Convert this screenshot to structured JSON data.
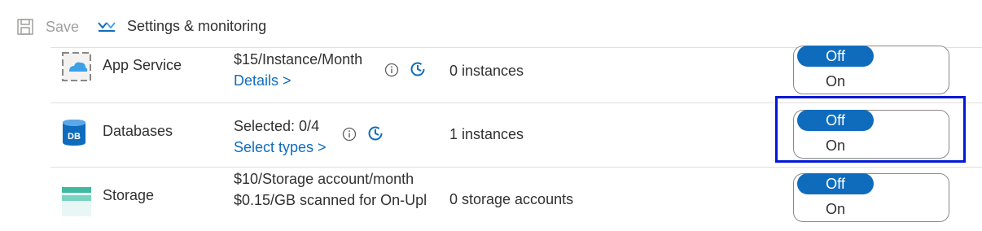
{
  "toolbar": {
    "save_label": "Save",
    "settings_label": "Settings & monitoring"
  },
  "plans": [
    {
      "name": "App Service",
      "icon": "app-service-icon",
      "pricing_line1": "$15/Instance/Month",
      "pricing_link": "Details >",
      "count": "0 instances",
      "toggle_off": "Off",
      "toggle_on": "On",
      "selected": "Off"
    },
    {
      "name": "Databases",
      "icon": "database-icon",
      "icon_text": "DB",
      "pricing_line1": "Selected: 0/4",
      "pricing_link": "Select types >",
      "count": "1 instances",
      "toggle_off": "Off",
      "toggle_on": "On",
      "selected": "Off"
    },
    {
      "name": "Storage",
      "icon": "storage-icon",
      "pricing_line1": "$10/Storage account/month",
      "pricing_line2": "$0.15/GB scanned for On-Upl",
      "count": "0 storage accounts",
      "toggle_off": "Off",
      "toggle_on": "On",
      "selected": "Off"
    }
  ],
  "colors": {
    "accent": "#0f6cbd",
    "highlight_border": "#0018d8"
  }
}
